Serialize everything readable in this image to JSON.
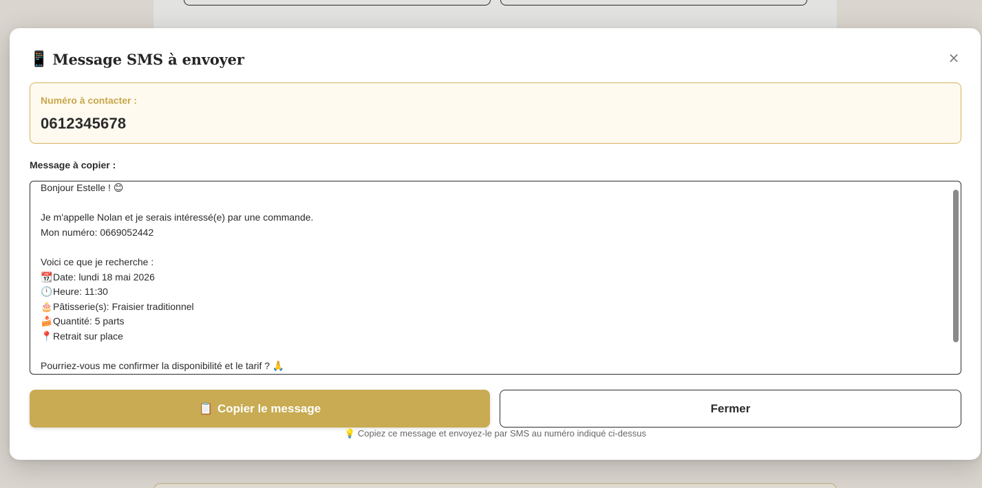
{
  "modal": {
    "title_icon": "📱",
    "title": "Message SMS à envoyer",
    "close_symbol": "×",
    "number_label": "Numéro à contacter :",
    "number_value": "0612345678",
    "message_label": "Message à copier :",
    "message_lines": [
      {
        "emoji": "",
        "text": "Bonjour Estelle ! 😊"
      },
      {
        "emoji": "",
        "text": ""
      },
      {
        "emoji": "",
        "text": "Je m'appelle Nolan et je serais intéressé(e) par une commande."
      },
      {
        "emoji": "",
        "text": "Mon numéro: 0669052442"
      },
      {
        "emoji": "",
        "text": ""
      },
      {
        "emoji": "",
        "text": "Voici ce que je recherche :"
      },
      {
        "emoji": "📆",
        "text": "Date: lundi 18 mai 2026"
      },
      {
        "emoji": "🕛",
        "text": "Heure: 11:30"
      },
      {
        "emoji": "🎂",
        "text": "Pâtisserie(s): Fraisier traditionnel"
      },
      {
        "emoji": "🍰",
        "text": "Quantité: 5 parts"
      },
      {
        "emoji": "📍",
        "text": "Retrait sur place"
      },
      {
        "emoji": "",
        "text": ""
      },
      {
        "emoji": "",
        "text": "Pourriez-vous me confirmer la disponibilité et le tarif ? 🙏"
      }
    ],
    "copy_button_icon": "📋",
    "copy_button_label": "Copier le message",
    "close_button_label": "Fermer",
    "hint_icon": "💡",
    "hint_text": "Copiez ce message et envoyez-le par SMS au numéro indiqué ci-dessus"
  },
  "colors": {
    "accent": "#c8ab52",
    "accent_text": "#c8a74a",
    "number_box_bg": "#fffaf0",
    "number_box_border": "#d2b35a"
  }
}
